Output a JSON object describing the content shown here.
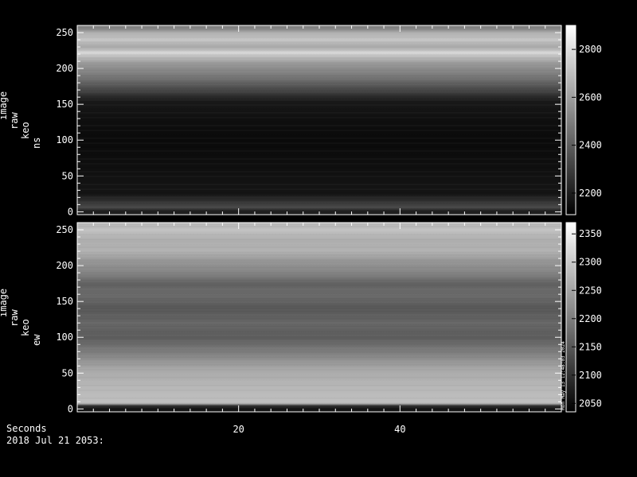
{
  "bottom": {
    "axis_label": "Seconds",
    "date_label": "2018 Jul 21 2053:"
  },
  "colors": {
    "background": "#000000",
    "axis": "#ffffff",
    "text": "#ffffff"
  },
  "chart_data": [
    {
      "type": "heatmap",
      "ylabel_lines": [
        "image",
        "raw",
        "keo",
        "ns"
      ],
      "x_range": [
        0,
        60
      ],
      "x_ticks": [
        20,
        40
      ],
      "y_range": [
        -4,
        260
      ],
      "y_ticks": [
        0,
        50,
        100,
        150,
        200,
        250
      ],
      "colorbar": {
        "range": [
          2110,
          2900
        ],
        "ticks": [
          2200,
          2400,
          2600,
          2800
        ]
      },
      "row_profile": [
        [
          2,
          0.12
        ],
        [
          6,
          0.3
        ],
        [
          14,
          0.2
        ],
        [
          25,
          0.08
        ],
        [
          45,
          0.07
        ],
        [
          80,
          0.05
        ],
        [
          100,
          0.04
        ],
        [
          130,
          0.06
        ],
        [
          155,
          0.1
        ],
        [
          170,
          0.28
        ],
        [
          190,
          0.48
        ],
        [
          205,
          0.58
        ],
        [
          215,
          0.72
        ],
        [
          222,
          0.85
        ],
        [
          230,
          0.65
        ],
        [
          240,
          0.78
        ],
        [
          250,
          0.68
        ],
        [
          256,
          0.5
        ]
      ]
    },
    {
      "type": "heatmap",
      "ylabel_lines": [
        "image",
        "raw",
        "keo",
        "ew"
      ],
      "x_range": [
        0,
        60
      ],
      "x_ticks": [
        20,
        40
      ],
      "y_range": [
        -4,
        260
      ],
      "y_ticks": [
        0,
        50,
        100,
        150,
        200,
        250
      ],
      "colorbar": {
        "range": [
          2035,
          2370
        ],
        "ticks": [
          2050,
          2100,
          2150,
          2200,
          2250,
          2300,
          2350
        ]
      },
      "colorbar_note": "Mon May 13 12:48:03 2024",
      "row_profile": [
        [
          0,
          0.08
        ],
        [
          4,
          0.15
        ],
        [
          8,
          0.75
        ],
        [
          30,
          0.72
        ],
        [
          55,
          0.66
        ],
        [
          75,
          0.52
        ],
        [
          100,
          0.36
        ],
        [
          120,
          0.4
        ],
        [
          140,
          0.34
        ],
        [
          160,
          0.42
        ],
        [
          175,
          0.38
        ],
        [
          190,
          0.52
        ],
        [
          205,
          0.58
        ],
        [
          220,
          0.7
        ],
        [
          235,
          0.68
        ],
        [
          250,
          0.76
        ],
        [
          256,
          0.72
        ]
      ]
    }
  ]
}
